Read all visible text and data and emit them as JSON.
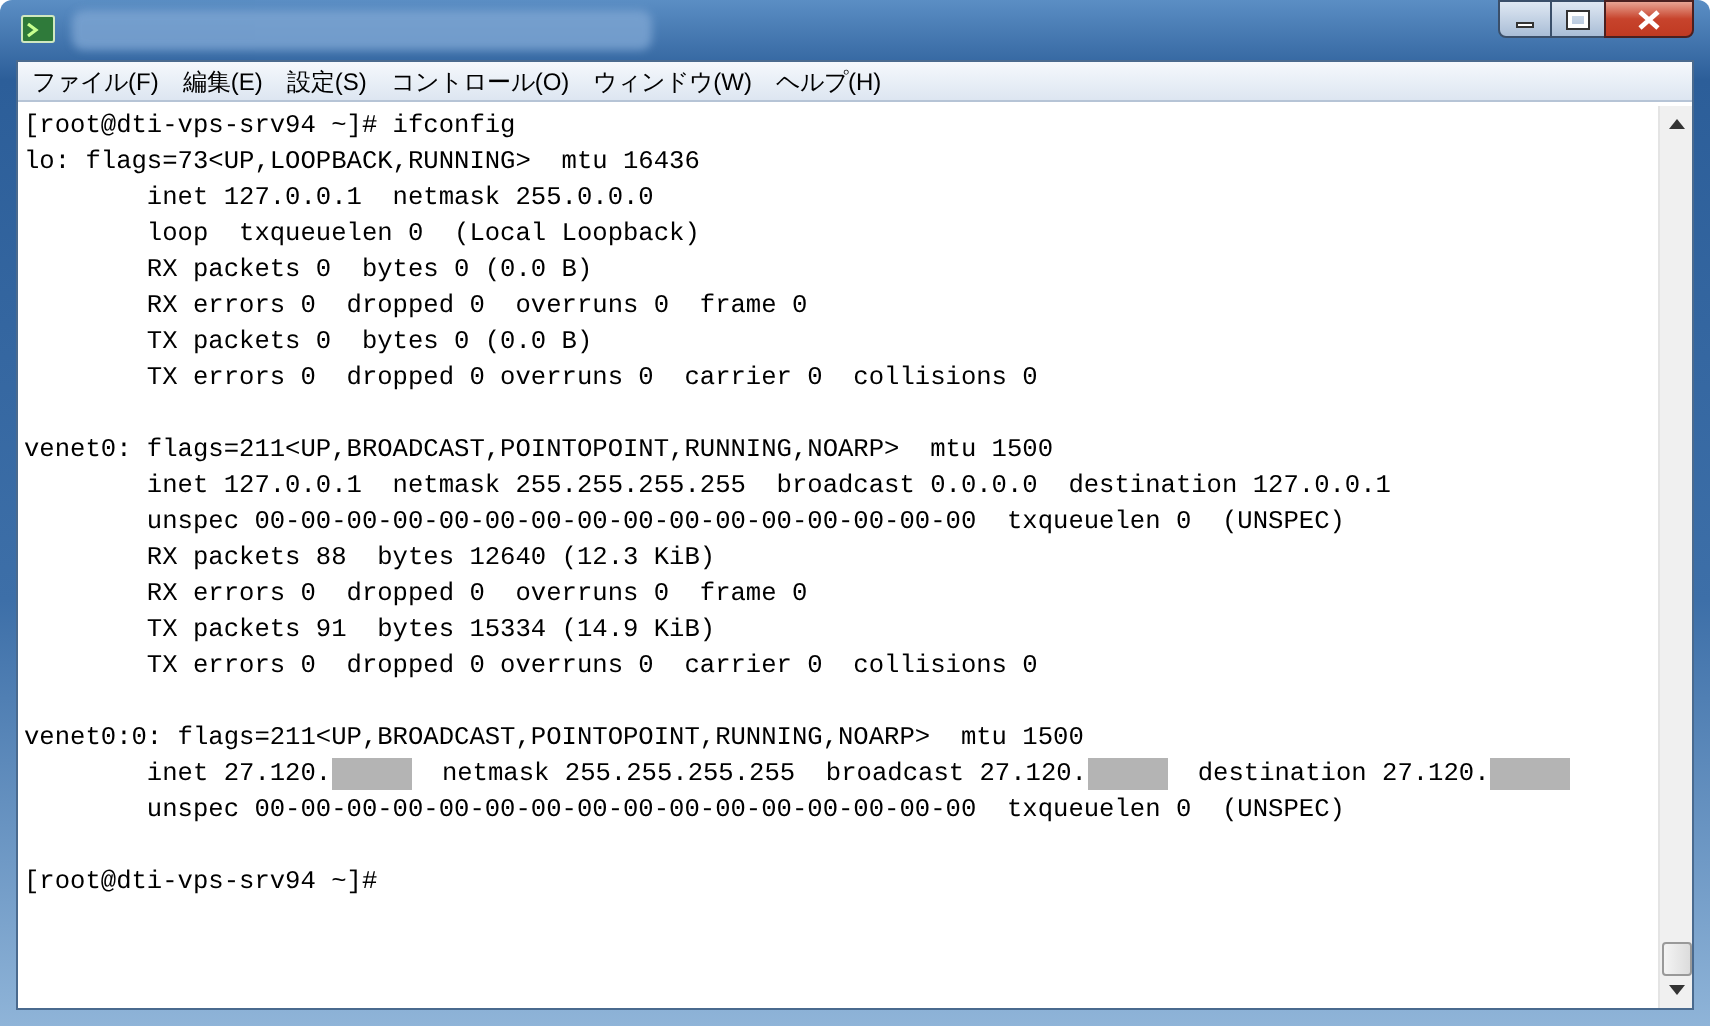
{
  "menu": [
    {
      "label": "ファイル(F)"
    },
    {
      "label": "編集(E)"
    },
    {
      "label": "設定(S)"
    },
    {
      "label": "コントロール(O)"
    },
    {
      "label": "ウィンドウ(W)"
    },
    {
      "label": "ヘルプ(H)"
    }
  ],
  "terminal": {
    "lines": [
      {
        "kind": "text",
        "segments": [
          {
            "kind": "text",
            "text": "[root@dti-vps-srv94 ~]# ifconfig"
          }
        ]
      },
      {
        "kind": "text",
        "segments": [
          {
            "kind": "text",
            "text": "lo: flags=73<UP,LOOPBACK,RUNNING>  mtu 16436"
          }
        ]
      },
      {
        "kind": "text",
        "segments": [
          {
            "kind": "text",
            "text": "        inet 127.0.0.1  netmask 255.0.0.0"
          }
        ]
      },
      {
        "kind": "text",
        "segments": [
          {
            "kind": "text",
            "text": "        loop  txqueuelen 0  (Local Loopback)"
          }
        ]
      },
      {
        "kind": "text",
        "segments": [
          {
            "kind": "text",
            "text": "        RX packets 0  bytes 0 (0.0 B)"
          }
        ]
      },
      {
        "kind": "text",
        "segments": [
          {
            "kind": "text",
            "text": "        RX errors 0  dropped 0  overruns 0  frame 0"
          }
        ]
      },
      {
        "kind": "text",
        "segments": [
          {
            "kind": "text",
            "text": "        TX packets 0  bytes 0 (0.0 B)"
          }
        ]
      },
      {
        "kind": "text",
        "segments": [
          {
            "kind": "text",
            "text": "        TX errors 0  dropped 0 overruns 0  carrier 0  collisions 0"
          }
        ]
      },
      {
        "kind": "blank"
      },
      {
        "kind": "text",
        "segments": [
          {
            "kind": "text",
            "text": "venet0: flags=211<UP,BROADCAST,POINTOPOINT,RUNNING,NOARP>  mtu 1500"
          }
        ]
      },
      {
        "kind": "text",
        "segments": [
          {
            "kind": "text",
            "text": "        inet 127.0.0.1  netmask 255.255.255.255  broadcast 0.0.0.0  destination 127.0.0.1"
          }
        ]
      },
      {
        "kind": "text",
        "segments": [
          {
            "kind": "text",
            "text": "        unspec 00-00-00-00-00-00-00-00-00-00-00-00-00-00-00-00  txqueuelen 0  (UNSPEC)"
          }
        ]
      },
      {
        "kind": "text",
        "segments": [
          {
            "kind": "text",
            "text": "        RX packets 88  bytes 12640 (12.3 KiB)"
          }
        ]
      },
      {
        "kind": "text",
        "segments": [
          {
            "kind": "text",
            "text": "        RX errors 0  dropped 0  overruns 0  frame 0"
          }
        ]
      },
      {
        "kind": "text",
        "segments": [
          {
            "kind": "text",
            "text": "        TX packets 91  bytes 15334 (14.9 KiB)"
          }
        ]
      },
      {
        "kind": "text",
        "segments": [
          {
            "kind": "text",
            "text": "        TX errors 0  dropped 0 overruns 0  carrier 0  collisions 0"
          }
        ]
      },
      {
        "kind": "blank"
      },
      {
        "kind": "text",
        "segments": [
          {
            "kind": "text",
            "text": "venet0:0: flags=211<UP,BROADCAST,POINTOPOINT,RUNNING,NOARP>  mtu 1500"
          }
        ]
      },
      {
        "kind": "text",
        "segments": [
          {
            "kind": "text",
            "text": "        inet 27.120."
          },
          {
            "kind": "redacted"
          },
          {
            "kind": "text",
            "text": "  netmask 255.255.255.255  broadcast 27.120."
          },
          {
            "kind": "redacted"
          },
          {
            "kind": "text",
            "text": "  destination 27.120."
          },
          {
            "kind": "redacted"
          }
        ]
      },
      {
        "kind": "text",
        "segments": [
          {
            "kind": "text",
            "text": "        unspec 00-00-00-00-00-00-00-00-00-00-00-00-00-00-00-00  txqueuelen 0  (UNSPEC)"
          }
        ]
      },
      {
        "kind": "blank"
      },
      {
        "kind": "text",
        "segments": [
          {
            "kind": "text",
            "text": "[root@dti-vps-srv94 ~]#"
          }
        ]
      }
    ]
  }
}
